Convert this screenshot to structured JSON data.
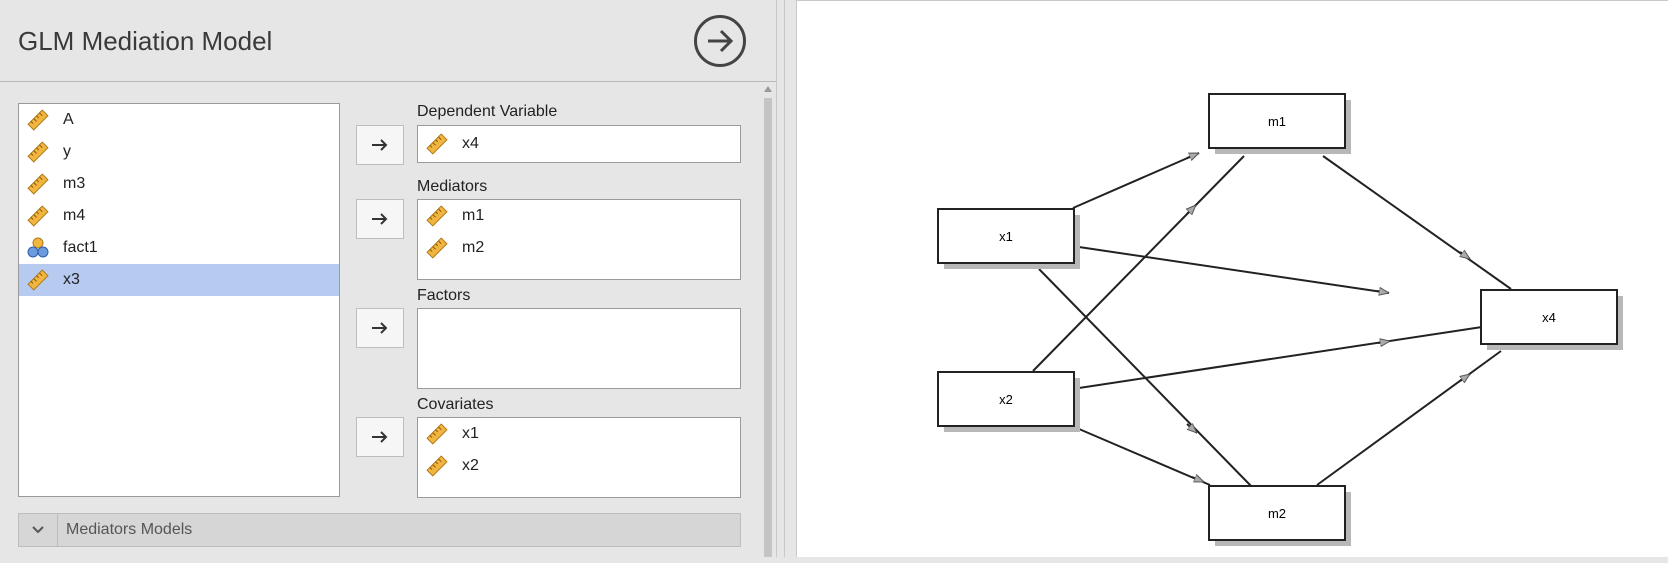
{
  "header": {
    "title": "GLM Mediation Model"
  },
  "variables": [
    {
      "label": "A",
      "icon": "ruler-icon",
      "selected": false
    },
    {
      "label": "y",
      "icon": "ruler-icon",
      "selected": false
    },
    {
      "label": "m3",
      "icon": "ruler-icon",
      "selected": false
    },
    {
      "label": "m4",
      "icon": "ruler-icon",
      "selected": false
    },
    {
      "label": "fact1",
      "icon": "nominal-icon",
      "selected": false
    },
    {
      "label": "x3",
      "icon": "ruler-icon",
      "selected": true
    }
  ],
  "dependent": {
    "label": "Dependent Variable",
    "items": [
      "x4"
    ]
  },
  "mediators": {
    "label": "Mediators",
    "items": [
      "m1",
      "m2"
    ]
  },
  "factors": {
    "label": "Factors",
    "items": []
  },
  "covariates": {
    "label": "Covariates",
    "items": [
      "x1",
      "x2"
    ]
  },
  "collapsible": {
    "label": "Mediators Models"
  },
  "diagram": {
    "nodes": [
      "m1",
      "x1",
      "x4",
      "x2",
      "m2"
    ]
  },
  "colors": {
    "selection": "#b7caf0",
    "ruler": "#f0b63f"
  }
}
